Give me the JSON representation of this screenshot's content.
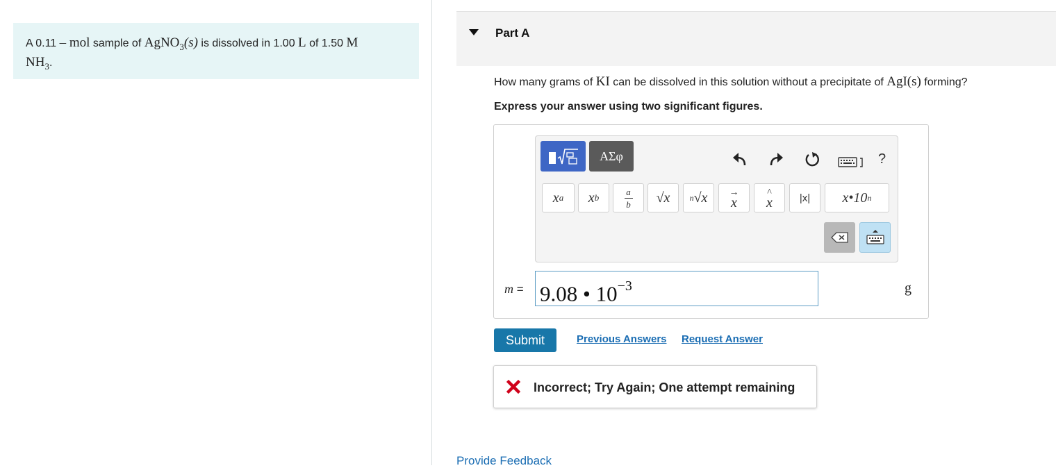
{
  "problem": {
    "text_prefix": "A 0.11 ",
    "dash": "– ",
    "mol": "mol",
    "text_mid": " sample of ",
    "compound_base": "AgNO",
    "compound_sub": "3",
    "compound_state": "(s)",
    "text_mid2": " is dissolved in 1.00 ",
    "unit_L": "L",
    "text_mid3": " of 1.50 ",
    "unit_M": "M",
    "ammonia_base": "NH",
    "ammonia_sub": "3",
    "ammonia_end": "."
  },
  "part": {
    "title": "Part A"
  },
  "question": {
    "prefix": "How many grams of ",
    "reagent": "KI",
    "mid": " can be dissolved in this solution without a precipitate of ",
    "precipitate": "AgI(s)",
    "suffix": " forming?"
  },
  "instruction": "Express your answer using two significant figures.",
  "toolbar": {
    "symbols_label": "ΑΣφ",
    "help_label": "?",
    "math_buttons": {
      "superscript": "x",
      "superscript_sup": "a",
      "subscript": "x",
      "subscript_sub": "b",
      "fraction_num": "a",
      "fraction_den": "b",
      "sqrt": "√x",
      "nroot_index": "n",
      "nroot": "√x",
      "vector": "x",
      "hat": "x",
      "abs": "|x|",
      "sci": "x•10",
      "sci_exp": "n"
    }
  },
  "answer": {
    "variable": "m",
    "equals": " = ",
    "mantissa": "9.08 • 10",
    "exponent": "−3",
    "unit": "g"
  },
  "actions": {
    "submit": "Submit",
    "previous_answers": "Previous Answers",
    "request_answer": "Request Answer"
  },
  "feedback": {
    "message": "Incorrect; Try Again; One attempt remaining",
    "status_color": "#d0021b"
  },
  "footer": {
    "provide_feedback": "Provide Feedback"
  },
  "colors": {
    "problem_bg": "#e6f5f6",
    "accent_blue": "#1877a9",
    "link_blue": "#1a6db3",
    "templates_blue": "#3e66c5"
  }
}
